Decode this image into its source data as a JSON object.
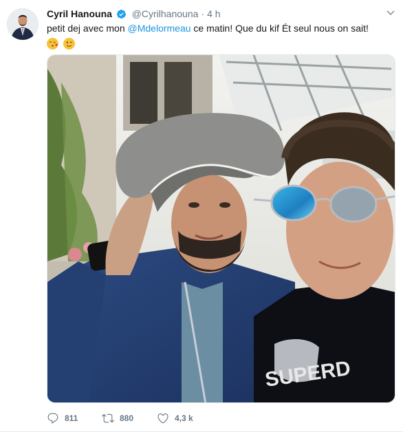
{
  "author": {
    "name": "Cyril Hanouna",
    "handle": "@Cyrilhanouna",
    "separator": "·",
    "time": "4 h",
    "verified": true
  },
  "tweet": {
    "text_before": "petit dej avec mon ",
    "mention": "@Mdelormeau",
    "text_after": " ce matin! Que du kif Ét seul nous on sait!",
    "emojis": [
      "kissing-face-with-heart-emoji",
      "winking-face-emoji"
    ]
  },
  "actions": {
    "replies": "811",
    "retweets": "880",
    "likes": "4,3 k"
  },
  "icons": {
    "reply": "reply-icon",
    "retweet": "retweet-icon",
    "like": "heart-icon",
    "menu": "chevron-down-icon",
    "verified": "verified-badge-icon"
  },
  "colors": {
    "link": "#1b95e0",
    "text": "#14171a",
    "muted": "#657786",
    "verified": "#1da1f2"
  }
}
